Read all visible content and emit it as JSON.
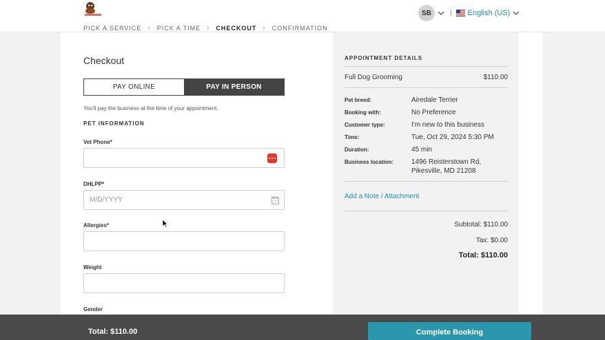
{
  "breadcrumb": {
    "steps": [
      "PICK A SERVICE",
      "PICK A TIME",
      "CHECKOUT",
      "CONFIRMATION"
    ]
  },
  "user": {
    "initials": "SB",
    "language": "English (US)"
  },
  "checkout": {
    "title": "Checkout",
    "pay_online_label": "PAY ONLINE",
    "pay_in_person_label": "PAY IN PERSON",
    "selected_payment": "PAY IN PERSON",
    "pay_note": "You'll pay the business at the time of your appointment.",
    "section_title": "PET INFORMATION",
    "fields": [
      {
        "label": "Vet Phone*",
        "value": "",
        "placeholder": ""
      },
      {
        "label": "DHLPP*",
        "value": "",
        "placeholder": "M/D/YYYY"
      },
      {
        "label": "Allergies*",
        "value": "",
        "placeholder": ""
      },
      {
        "label": "Weight",
        "value": "",
        "placeholder": ""
      }
    ],
    "gender_label": "Gender"
  },
  "details": {
    "title": "APPOINTMENT DETAILS",
    "service_name": "Full Dog Grooming",
    "service_price": "$110.00",
    "rows": [
      {
        "label": "Pet breed:",
        "value": "Airedale Terrier"
      },
      {
        "label": "Booking with:",
        "value": "No Preference"
      },
      {
        "label": "Customer type:",
        "value": "I'm new to this business"
      },
      {
        "label": "Time:",
        "value": "Tue, Oct 29, 2024 5:30 PM"
      },
      {
        "label": "Duration:",
        "value": "45 min"
      },
      {
        "label": "Business location:",
        "value": "1496 Reisterstown Rd,",
        "value2": "Pikesville, MD 21208"
      }
    ],
    "add_note_label": "Add a Note / Attachment",
    "subtotal": "Subtotal: $110.00",
    "tax": "Tax: $0.00",
    "total": "Total: $110.00"
  },
  "footer": {
    "total": "Total: $110.00",
    "complete_label": "Complete Booking"
  },
  "colors": {
    "accent": "#1e8fa6",
    "button": "#2b97ad",
    "dark": "#444444"
  }
}
